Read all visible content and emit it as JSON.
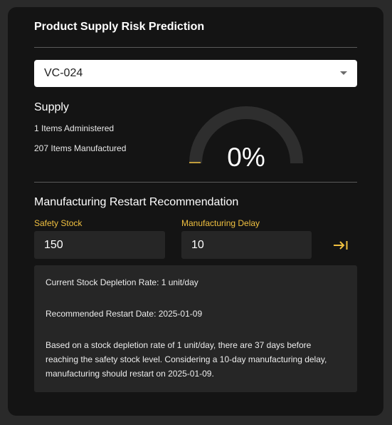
{
  "card": {
    "title": "Product Supply Risk Prediction"
  },
  "product_select": {
    "value": "VC-024"
  },
  "supply": {
    "heading": "Supply",
    "administered": "1 Items Administered",
    "manufactured": "207 Items Manufactured"
  },
  "gauge": {
    "value": 0,
    "label": "0%",
    "track_color": "#2e2e2e",
    "fill_color": "#f0c040"
  },
  "restart": {
    "heading": "Manufacturing Restart Recommendation",
    "safety_stock_label": "Safety Stock",
    "safety_stock_value": "150",
    "delay_label": "Manufacturing Delay",
    "delay_value": "10",
    "submit_icon": "arrow-right-to-bar-icon"
  },
  "result": {
    "depletion_rate": "Current Stock Depletion Rate: 1 unit/day",
    "restart_date": "Recommended Restart Date: 2025-01-09",
    "explanation": "Based on a stock depletion rate of 1 unit/day, there are 37 days before reaching the safety stock level. Considering a 10-day manufacturing delay, manufacturing should restart on 2025-01-09."
  },
  "colors": {
    "accent": "#f0c040",
    "card_background": "#141414",
    "page_background": "#2a2a2a"
  }
}
